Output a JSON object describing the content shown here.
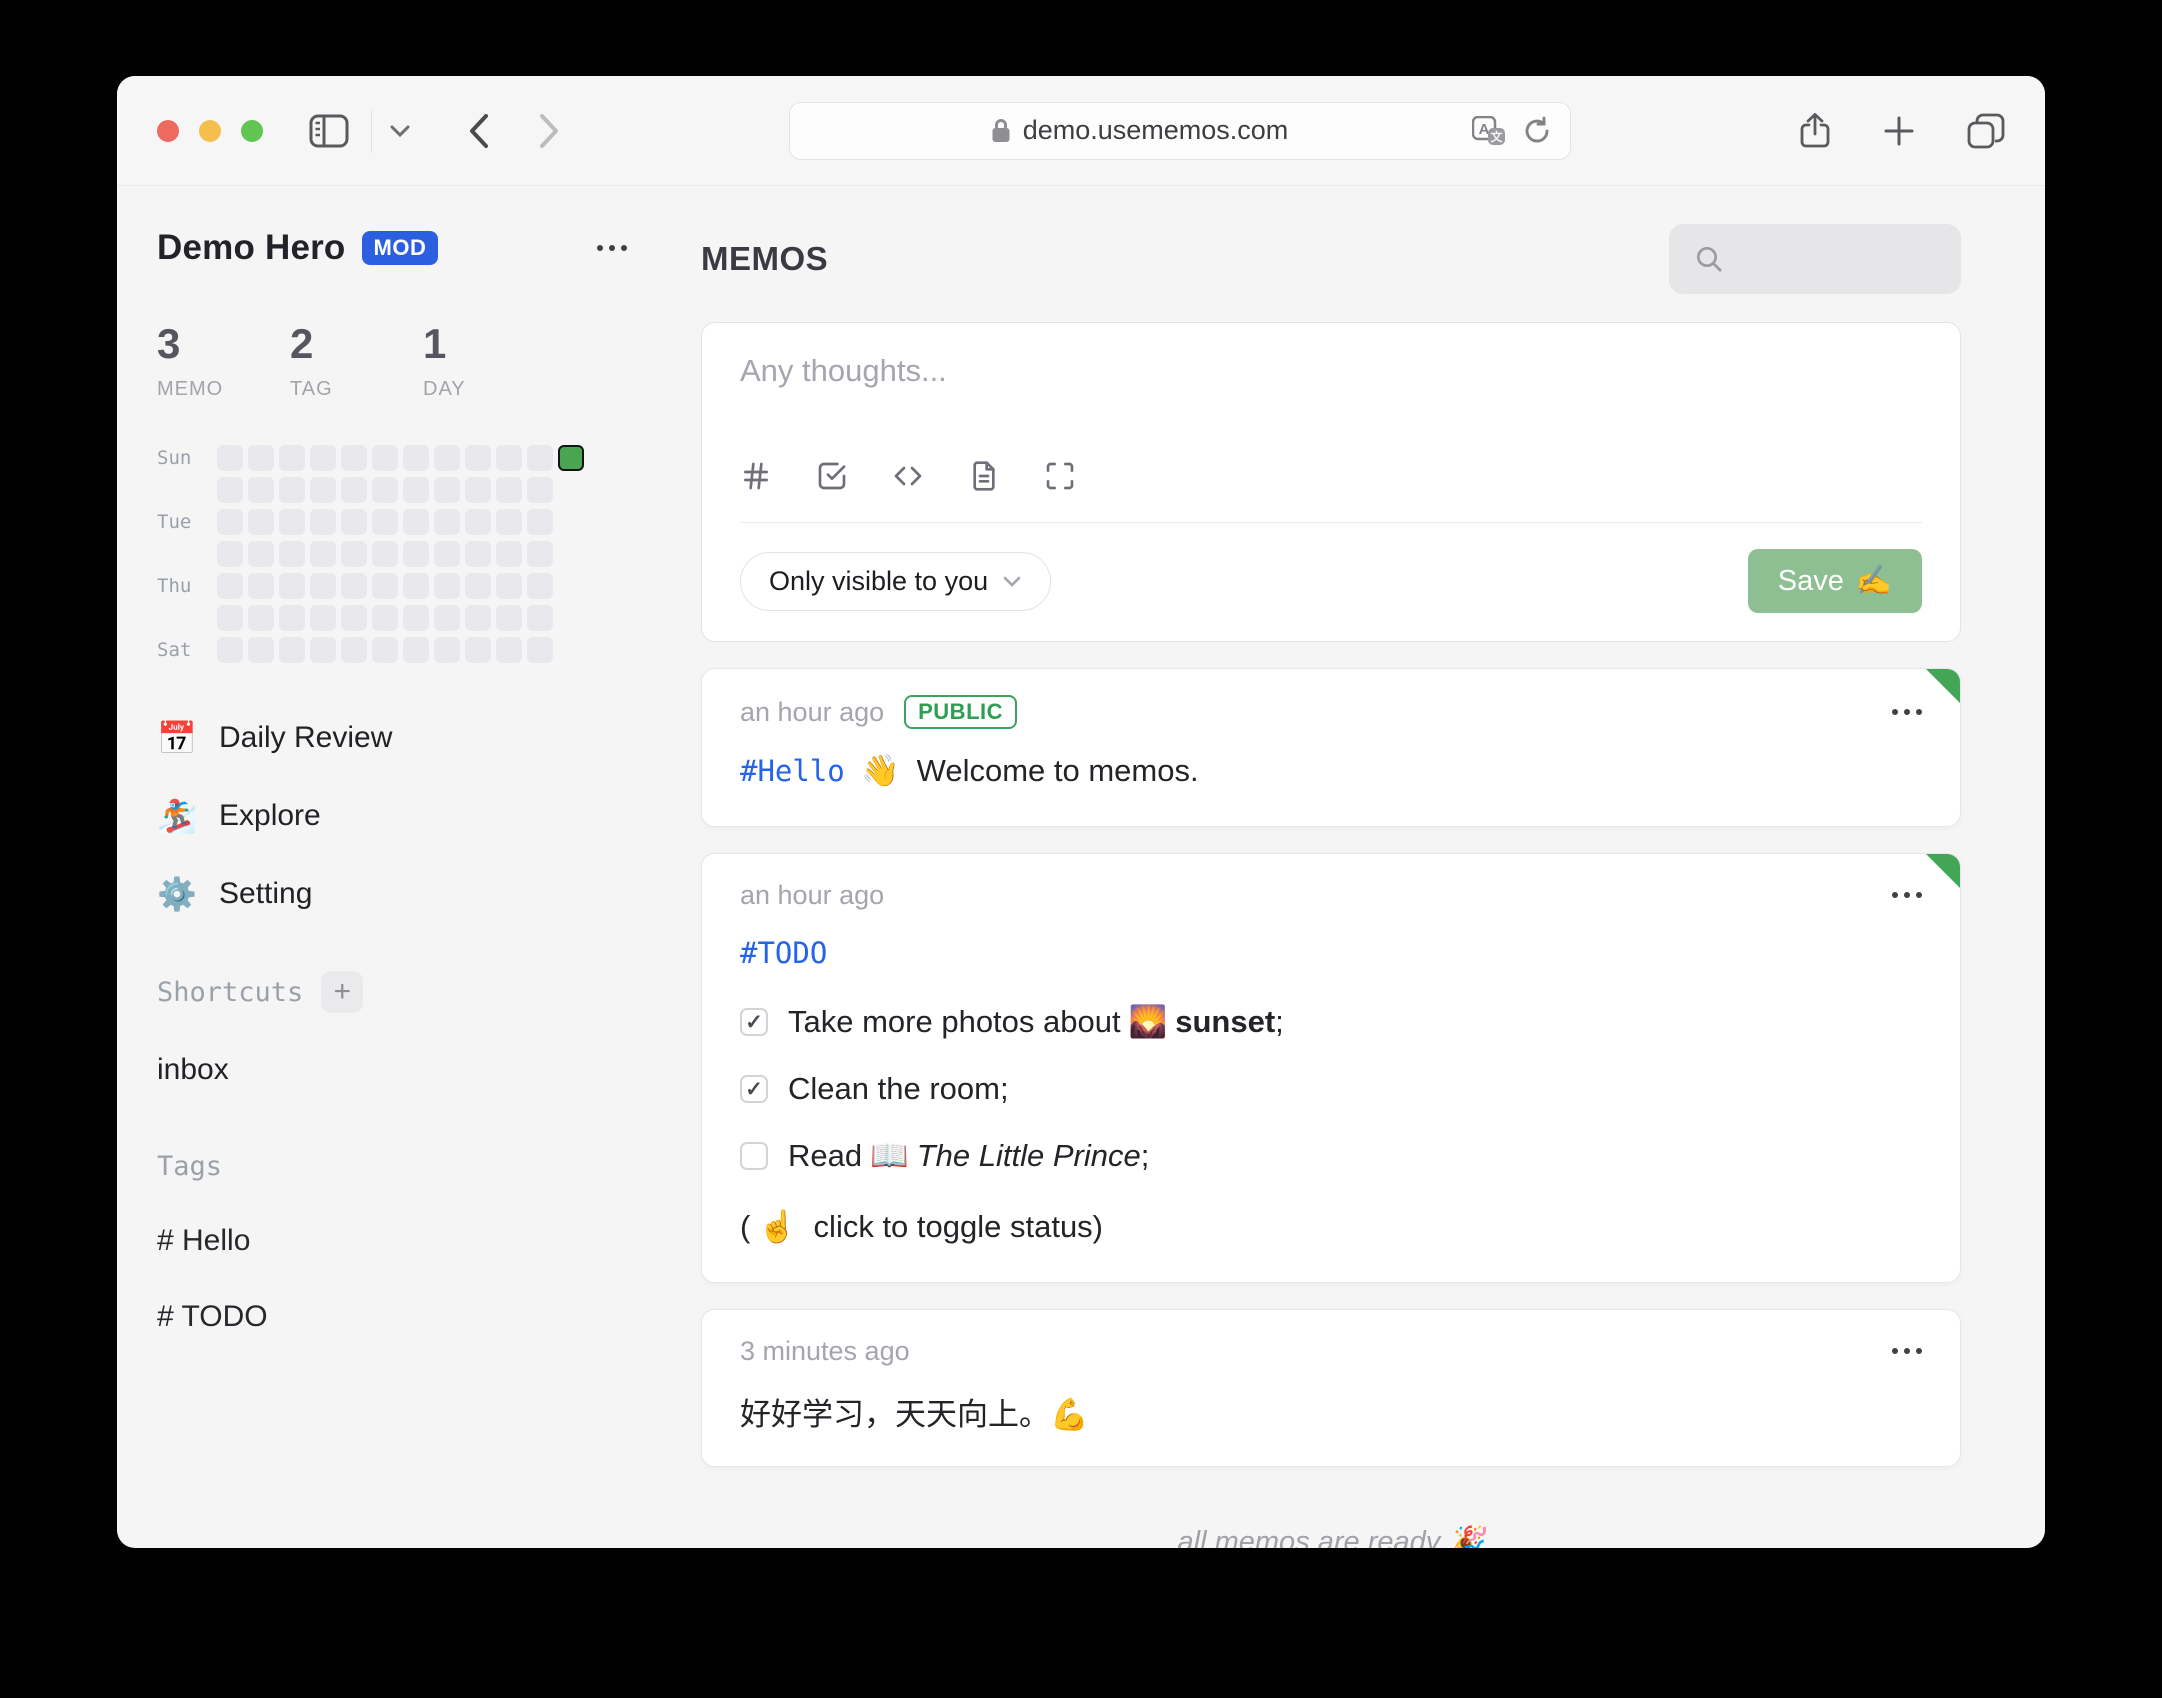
{
  "browser": {
    "url": "demo.usememos.com",
    "colors": {
      "light_red": "#ec6a5e",
      "light_yellow": "#f5bf4f",
      "light_green": "#61c554"
    }
  },
  "sidebar": {
    "user": {
      "name": "Demo Hero",
      "badge": "MOD"
    },
    "stats": [
      {
        "value": "3",
        "label": "MEMO"
      },
      {
        "value": "2",
        "label": "TAG"
      },
      {
        "value": "1",
        "label": "DAY"
      }
    ],
    "heatmap": {
      "day_rows": [
        "Sun",
        "",
        "Tue",
        "",
        "Thu",
        "",
        "Sat"
      ],
      "weeks": 12,
      "rows": 7,
      "cell_color": "#e9e8ec",
      "today_color": "#4aa553"
    },
    "nav": [
      {
        "emoji": "📅",
        "label": "Daily Review"
      },
      {
        "emoji": "🏂",
        "label": "Explore"
      },
      {
        "emoji": "⚙️",
        "label": "Setting"
      }
    ],
    "shortcuts": {
      "label": "Shortcuts",
      "add": "+",
      "items": [
        "inbox"
      ]
    },
    "tags": {
      "label": "Tags",
      "items": [
        "# Hello",
        "# TODO"
      ]
    }
  },
  "main": {
    "title": "MEMOS",
    "editor": {
      "placeholder": "Any thoughts...",
      "visibility": "Only visible to you",
      "save_label": "Save",
      "save_emoji": "✍️",
      "save_color": "#8dbf92"
    },
    "memos": [
      {
        "time": "an hour ago",
        "badge": "PUBLIC",
        "tag": "#Hello",
        "emoji": "👋",
        "text": "Welcome to memos.",
        "pinned": true
      },
      {
        "time": "an hour ago",
        "tag": "#TODO",
        "tasks": [
          {
            "checked": true,
            "before": "Take more photos about",
            "emoji": "🌄",
            "bold": "sunset",
            "after": ";"
          },
          {
            "checked": true,
            "before": "Clean the room;",
            "emoji": "",
            "bold": "",
            "after": ""
          },
          {
            "checked": false,
            "before": "Read",
            "emoji": "📖",
            "italic": "The Little Prince",
            "after": ";"
          }
        ],
        "note_open": "(",
        "note_emoji": "☝️",
        "note_text": " click to toggle status)",
        "pinned": true
      },
      {
        "time": "3 minutes ago",
        "text": "好好学习，天天向上。💪",
        "pinned": false
      }
    ],
    "footer": "all memos are ready 🎉"
  }
}
